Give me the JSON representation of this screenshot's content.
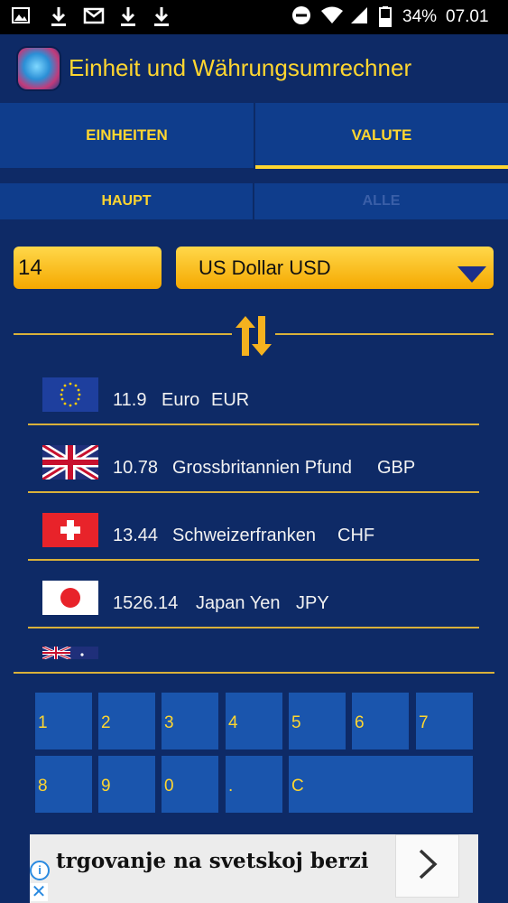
{
  "status_bar": {
    "icons": [
      "image-icon",
      "download-icon",
      "gmail-icon",
      "download-icon",
      "download-icon",
      "do-not-disturb-icon",
      "wifi-icon",
      "signal-icon",
      "battery-icon"
    ],
    "battery": "34%",
    "time": "07.01"
  },
  "app": {
    "title": "Einheit und Währungsumrechner"
  },
  "tabs": [
    {
      "label": "EINHEITEN"
    },
    {
      "label": "VALUTE"
    }
  ],
  "subtabs": [
    {
      "label": "HAUPT"
    },
    {
      "label": "ALLE"
    }
  ],
  "converter": {
    "amount": "14",
    "currency": "US Dollar USD"
  },
  "results": [
    {
      "value": "11.9",
      "name": "Euro",
      "code": "EUR",
      "flag": "eu-flag"
    },
    {
      "value": "10.78",
      "name": "Grossbritannien Pfund",
      "code": "GBP",
      "flag": "uk-flag"
    },
    {
      "value": "13.44",
      "name": "Schweizerfranken",
      "code": "CHF",
      "flag": "swiss-flag"
    },
    {
      "value": "1526.14",
      "name": "Japan Yen",
      "code": "JPY",
      "flag": "japan-flag"
    }
  ],
  "keypad": {
    "row1": [
      "1",
      "2",
      "3",
      "4",
      "5",
      "6",
      "7"
    ],
    "row2": [
      "8",
      "9",
      "0",
      ".",
      "C"
    ]
  },
  "ad": {
    "text": "trgovanje na svetskoj berzi"
  },
  "colors": {
    "background": "#0e2a66",
    "accent": "#ffd630",
    "tab": "#0f3d8c",
    "key": "#1a55ad"
  }
}
